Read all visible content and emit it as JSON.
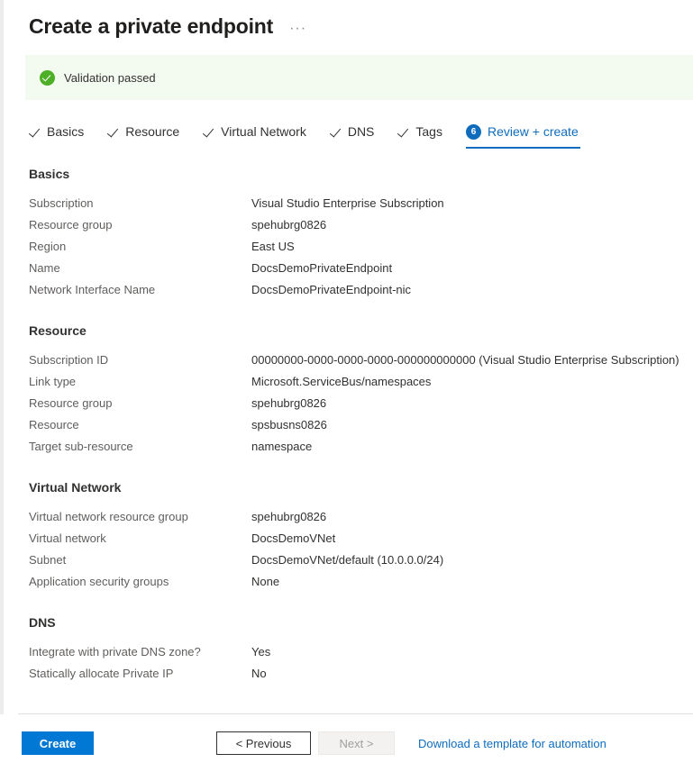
{
  "header": {
    "title": "Create a private endpoint",
    "more_label": "···"
  },
  "banner": {
    "text": "Validation passed",
    "icon": "check-circle-icon",
    "background": "#f3faef",
    "icon_color": "#4caf25"
  },
  "tabs": [
    {
      "label": "Basics",
      "state": "completed",
      "icon": "check-icon"
    },
    {
      "label": "Resource",
      "state": "completed",
      "icon": "check-icon"
    },
    {
      "label": "Virtual Network",
      "state": "completed",
      "icon": "check-icon"
    },
    {
      "label": "DNS",
      "state": "completed",
      "icon": "check-icon"
    },
    {
      "label": "Tags",
      "state": "completed",
      "icon": "check-icon"
    },
    {
      "label": "Review + create",
      "state": "active",
      "badge": "6"
    }
  ],
  "sections": [
    {
      "title": "Basics",
      "rows": [
        {
          "label": "Subscription",
          "value": "Visual Studio Enterprise Subscription"
        },
        {
          "label": "Resource group",
          "value": "spehubrg0826"
        },
        {
          "label": "Region",
          "value": "East US"
        },
        {
          "label": "Name",
          "value": "DocsDemoPrivateEndpoint"
        },
        {
          "label": "Network Interface Name",
          "value": "DocsDemoPrivateEndpoint-nic"
        }
      ]
    },
    {
      "title": "Resource",
      "rows": [
        {
          "label": "Subscription ID",
          "value": "00000000-0000-0000-0000-000000000000 (Visual Studio Enterprise Subscription)"
        },
        {
          "label": "Link type",
          "value": "Microsoft.ServiceBus/namespaces"
        },
        {
          "label": "Resource group",
          "value": "spehubrg0826"
        },
        {
          "label": "Resource",
          "value": "spsbusns0826"
        },
        {
          "label": "Target sub-resource",
          "value": "namespace"
        }
      ]
    },
    {
      "title": "Virtual Network",
      "rows": [
        {
          "label": "Virtual network resource group",
          "value": "spehubrg0826"
        },
        {
          "label": "Virtual network",
          "value": "DocsDemoVNet"
        },
        {
          "label": "Subnet",
          "value": "DocsDemoVNet/default (10.0.0.0/24)"
        },
        {
          "label": "Application security groups",
          "value": "None"
        }
      ]
    },
    {
      "title": "DNS",
      "rows": [
        {
          "label": "Integrate with private DNS zone?",
          "value": "Yes"
        },
        {
          "label": "Statically allocate Private IP",
          "value": "No"
        }
      ]
    }
  ],
  "footer": {
    "create_label": "Create",
    "previous_label": "< Previous",
    "next_label": "Next >",
    "next_disabled": true,
    "template_link": "Download a template for automation",
    "accent_color": "#0078d4",
    "link_color": "#0f6cbd"
  }
}
